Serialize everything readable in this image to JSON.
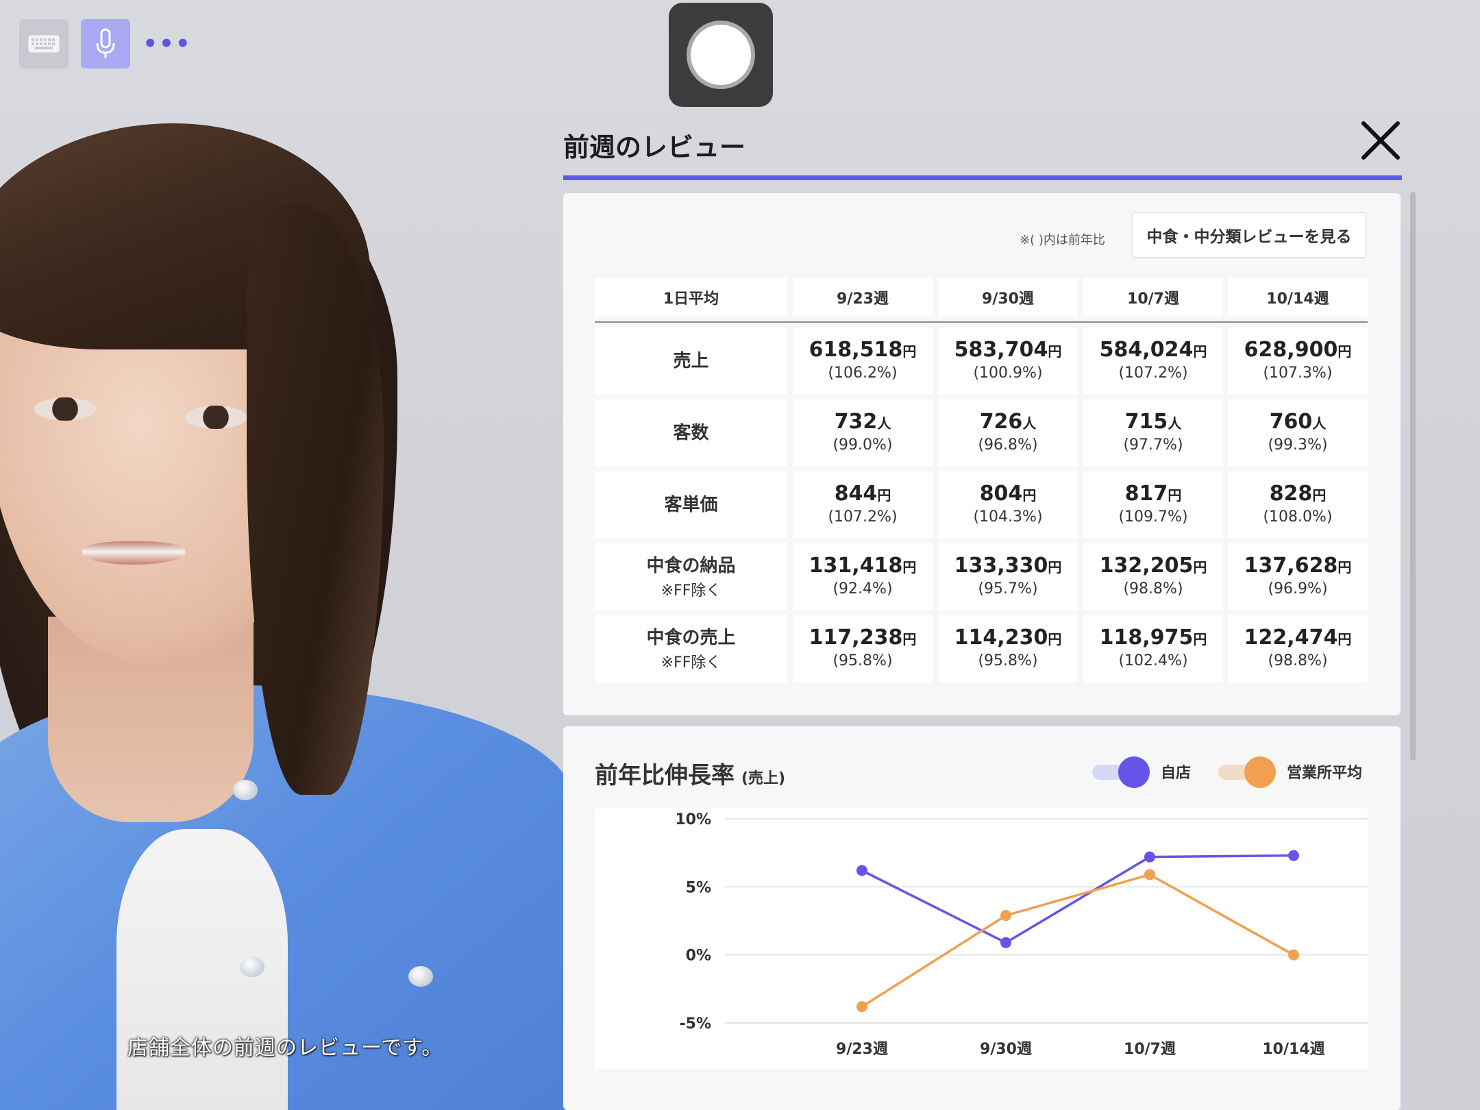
{
  "controls": {
    "keyboard_icon": "keyboard-icon",
    "mic_icon": "microphone-icon",
    "more_label": "•••"
  },
  "avatar": {
    "subtitle": "店舗全体の前週のレビューです。"
  },
  "panel": {
    "title": "前週のレビュー",
    "note": "※( )内は前年比",
    "subcategory_button": "中食・中分類レビューを見る",
    "accent_color": "#5a5ae8"
  },
  "table": {
    "corner_header": "1日平均",
    "columns": [
      "9/23週",
      "9/30週",
      "10/7週",
      "10/14週"
    ],
    "rows": [
      {
        "label": "売上",
        "sub": "",
        "unit": "円",
        "values": [
          "618,518",
          "583,704",
          "584,024",
          "628,900"
        ],
        "ratios": [
          "(106.2%)",
          "(100.9%)",
          "(107.2%)",
          "(107.3%)"
        ]
      },
      {
        "label": "客数",
        "sub": "",
        "unit": "人",
        "values": [
          "732",
          "726",
          "715",
          "760"
        ],
        "ratios": [
          "(99.0%)",
          "(96.8%)",
          "(97.7%)",
          "(99.3%)"
        ]
      },
      {
        "label": "客単価",
        "sub": "",
        "unit": "円",
        "values": [
          "844",
          "804",
          "817",
          "828"
        ],
        "ratios": [
          "(107.2%)",
          "(104.3%)",
          "(109.7%)",
          "(108.0%)"
        ]
      },
      {
        "label": "中食の納品",
        "sub": "※FF除く",
        "unit": "円",
        "values": [
          "131,418",
          "133,330",
          "132,205",
          "137,628"
        ],
        "ratios": [
          "(92.4%)",
          "(95.7%)",
          "(98.8%)",
          "(96.9%)"
        ]
      },
      {
        "label": "中食の売上",
        "sub": "※FF除く",
        "unit": "円",
        "values": [
          "117,238",
          "114,230",
          "118,975",
          "122,474"
        ],
        "ratios": [
          "(95.8%)",
          "(95.8%)",
          "(102.4%)",
          "(98.8%)"
        ]
      }
    ]
  },
  "chart_data": {
    "type": "line",
    "title": "前年比伸長率",
    "subtitle": "(売上)",
    "categories": [
      "9/23週",
      "9/30週",
      "10/7週",
      "10/14週"
    ],
    "yticks": [
      "10%",
      "5%",
      "0%",
      "-5%"
    ],
    "ylim": [
      -5,
      10
    ],
    "grid": true,
    "legend_position": "top-right",
    "series": [
      {
        "name": "自店",
        "color": "#6455e8",
        "values": [
          6.2,
          0.9,
          7.2,
          7.3
        ]
      },
      {
        "name": "営業所平均",
        "color": "#f0a050",
        "values": [
          -3.8,
          2.9,
          5.9,
          0.0
        ]
      }
    ]
  }
}
